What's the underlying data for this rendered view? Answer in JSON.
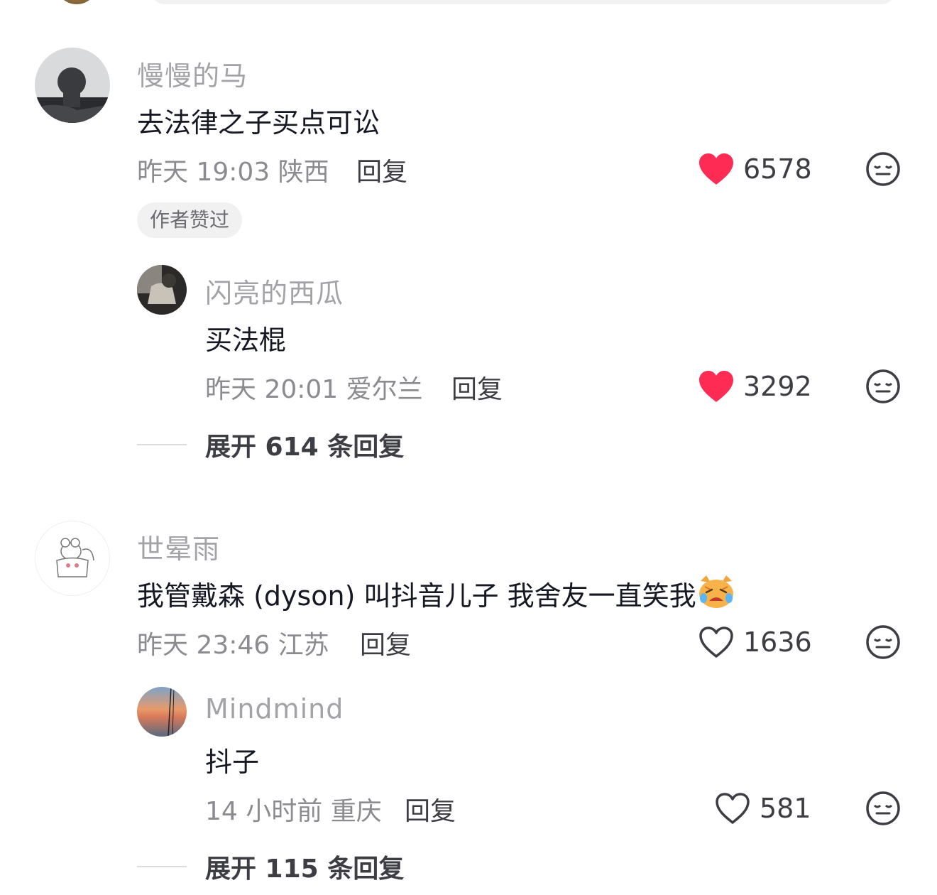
{
  "colors": {
    "like_red": "#fe2c55",
    "text_primary": "#161823",
    "text_secondary": "#8b8b90",
    "username": "#a3a3a7"
  },
  "comments": [
    {
      "username": "慢慢的马",
      "text": "去法律之子买点可讼",
      "time_location": "昨天 19:03 陕西",
      "reply_label": "回复",
      "likes": "6578",
      "liked": true,
      "badge": "作者赞过",
      "replies": [
        {
          "username": "闪亮的西瓜",
          "text": "买法棍",
          "time_location": "昨天 20:01 爱尔兰",
          "reply_label": "回复",
          "likes": "3292",
          "liked": true
        }
      ],
      "expand_label": "展开 614 条回复"
    },
    {
      "username": "世晕雨",
      "text": "我管戴森 (dyson) 叫抖音儿子 我舍友一直笑我",
      "text_emoji": "crying-cat-emoji",
      "time_location": "昨天 23:46 江苏",
      "reply_label": "回复",
      "likes": "1636",
      "liked": false,
      "replies": [
        {
          "username": "Mindmind",
          "text": "抖子",
          "time_location": "14 小时前 重庆",
          "reply_label": "回复",
          "likes": "581",
          "liked": false
        }
      ],
      "expand_label": "展开 115 条回复"
    }
  ]
}
